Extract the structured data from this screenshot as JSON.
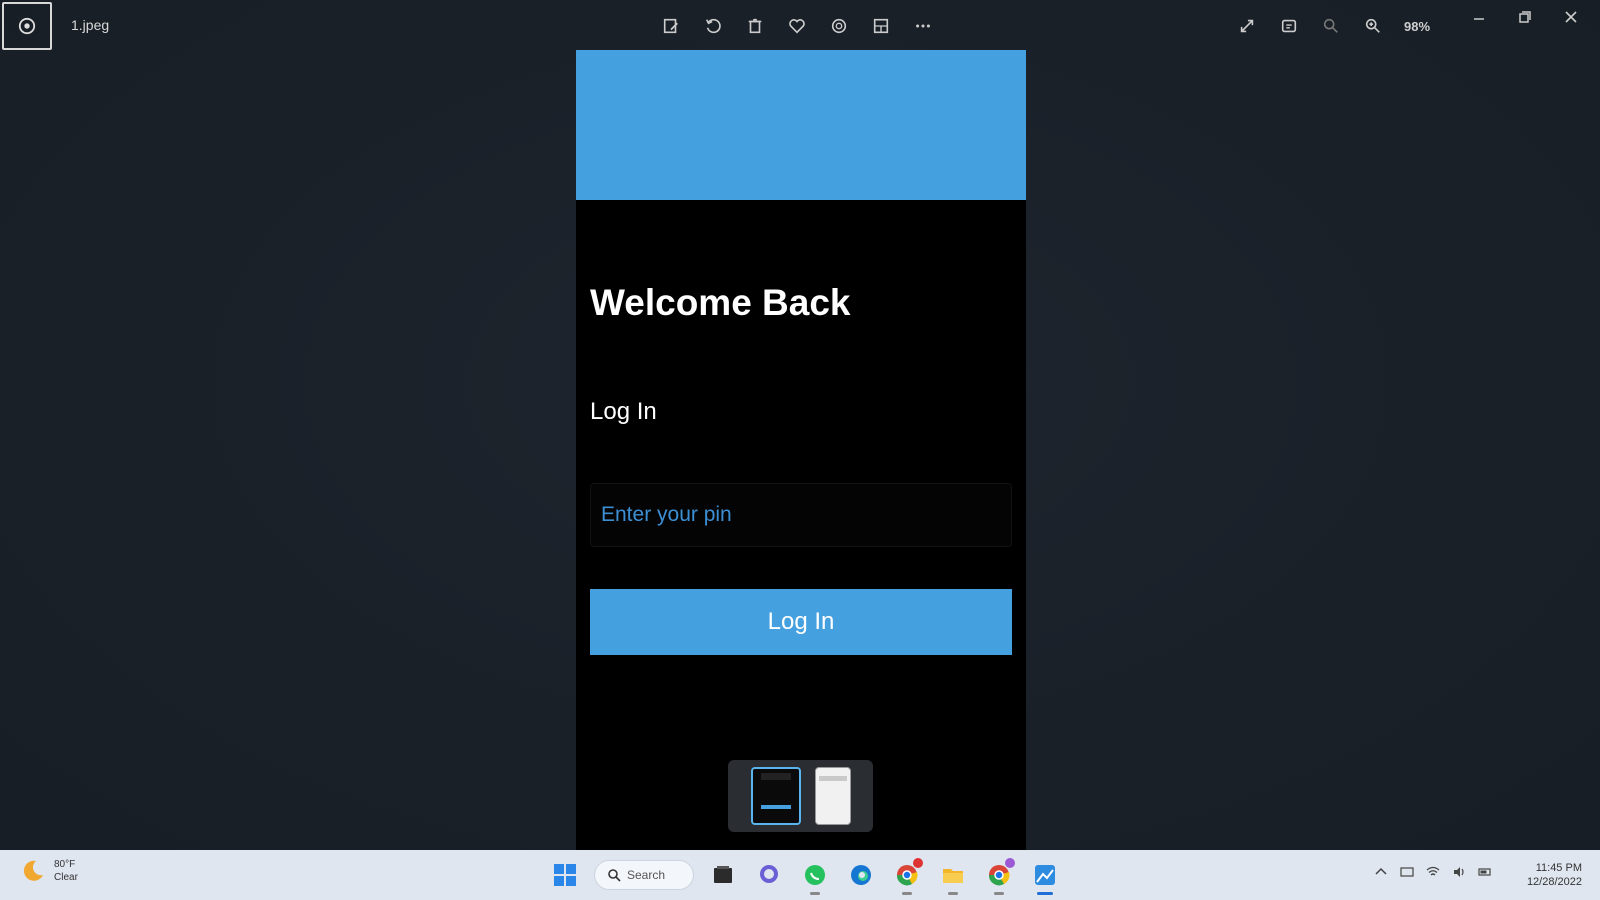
{
  "window": {
    "file_name": "1.jpeg",
    "zoom_level": "98%"
  },
  "phone": {
    "heading": "Welcome Back",
    "subheading": "Log In",
    "pin_placeholder": "Enter your pin",
    "login_button_label": "Log In",
    "accent_color": "#45a0df"
  },
  "taskbar": {
    "weather_temp": "80°F",
    "weather_condition": "Clear",
    "search_label": "Search",
    "time": "11:45 PM",
    "date": "12/28/2022"
  },
  "icons": {
    "toolbar": [
      "edit-icon",
      "rotate-icon",
      "delete-icon",
      "favorite-icon",
      "filter-icon",
      "crop-icon",
      "more-icon"
    ],
    "right_tools": [
      "fullscreen-icon",
      "info-icon",
      "zoom-out-icon",
      "zoom-in-icon"
    ],
    "taskbar": [
      "windows-start-icon",
      "search-icon",
      "file-explorer-icon",
      "chat-icon",
      "whatsapp-icon",
      "edge-icon",
      "chrome-icon",
      "folder-icon",
      "chrome-profile-icon",
      "photos-icon"
    ]
  }
}
